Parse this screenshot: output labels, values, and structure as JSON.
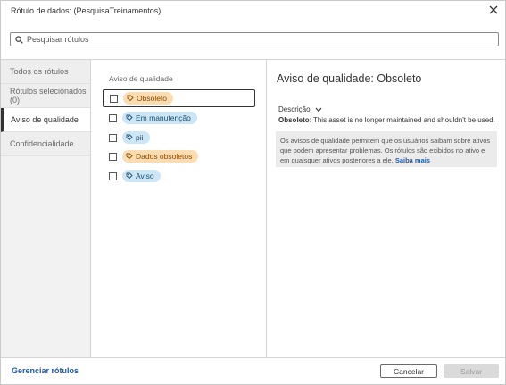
{
  "dialog": {
    "title": "Rótulo de dados: (PesquisaTreinamentos)",
    "close_icon": "close-icon"
  },
  "search": {
    "placeholder": "Pesquisar rótulos",
    "icon": "search-icon"
  },
  "leftnav": {
    "items": [
      {
        "label": "Todos os rótulos",
        "active": false
      },
      {
        "label": "Rótulos selecionados (0)",
        "active": false
      },
      {
        "label": "Aviso de qualidade",
        "active": true
      },
      {
        "label": "Confidencialidade",
        "active": false
      }
    ]
  },
  "middle": {
    "heading": "Aviso de qualidade",
    "labels": [
      {
        "text": "Obsoleto",
        "color": "orange",
        "checked": false,
        "focused": true
      },
      {
        "text": "Em manutenção",
        "color": "blue",
        "checked": false,
        "focused": false
      },
      {
        "text": "pii",
        "color": "blue",
        "checked": false,
        "focused": false
      },
      {
        "text": "Dados obsoletos",
        "color": "orange",
        "checked": false,
        "focused": false
      },
      {
        "text": "Aviso",
        "color": "blue",
        "checked": false,
        "focused": false
      }
    ]
  },
  "detail": {
    "title": "Aviso de qualidade: Obsoleto",
    "description_toggle": "Descrição",
    "description_name": "Obsoleto",
    "description_text": ": This asset is no longer maintained and shouldn't be used.",
    "info_text": "Os avisos de qualidade permitem que os usuários saibam sobre ativos que podem apresentar problemas. Os rótulos são exibidos no ativo e em quaisquer ativos posteriores a ele.",
    "info_link": "Saiba mais"
  },
  "footer": {
    "manage_link": "Gerenciar rótulos",
    "cancel_label": "Cancelar",
    "save_label": "Salvar"
  },
  "colors": {
    "orange_pill_bg": "#fcdcb0",
    "blue_pill_bg": "#cce6f6",
    "link": "#1f5aa5"
  }
}
